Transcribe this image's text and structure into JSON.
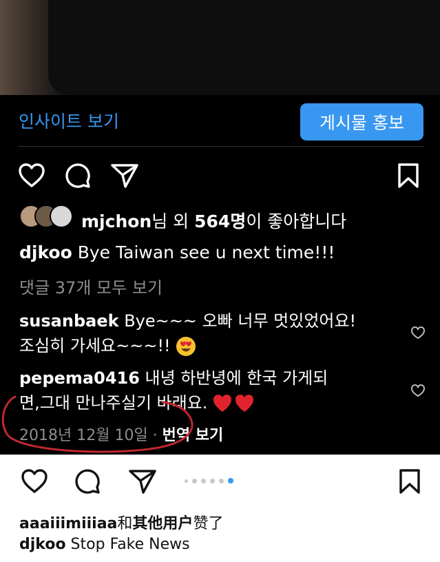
{
  "post1": {
    "insight_label": "인사이트 보기",
    "promote_label": "게시물 홍보",
    "likes": {
      "user": "mjchon",
      "mid": "님 외 ",
      "count": "564명",
      "suffix": "이 좋아합니다"
    },
    "caption": {
      "user": "djkoo",
      "text": " Bye Taiwan see u next time!!!"
    },
    "view_all_comments": "댓글 37개 모두 보기",
    "comments": [
      {
        "user": "susanbaek",
        "text_line1": " Bye~~~ 오빠 너무 멋있었어요!",
        "text_line2": "조심히 가세요~~~!! "
      },
      {
        "user": "pepema0416",
        "text_line1": " 내녕 하반녕에 한국 가게되",
        "text_line2": "면,그대 만나주실기 바래요. "
      }
    ],
    "date": "2018년 12월 10일",
    "separator": " · ",
    "translate_label": "번역 보기"
  },
  "post2": {
    "liked_by": {
      "user": "aaaiiimiiiaa",
      "connector": "和",
      "others": "其他用户",
      "suffix": "赞了"
    },
    "caption": {
      "user": "djkoo",
      "text": " Stop Fake News"
    },
    "carousel": {
      "count": 6,
      "active_index": 5
    }
  },
  "colors": {
    "accent": "#3897f0",
    "annotation": "#c0282d",
    "muted": "#8e8e8e"
  },
  "icons": [
    "heart-icon",
    "comment-icon",
    "share-icon",
    "bookmark-icon"
  ]
}
